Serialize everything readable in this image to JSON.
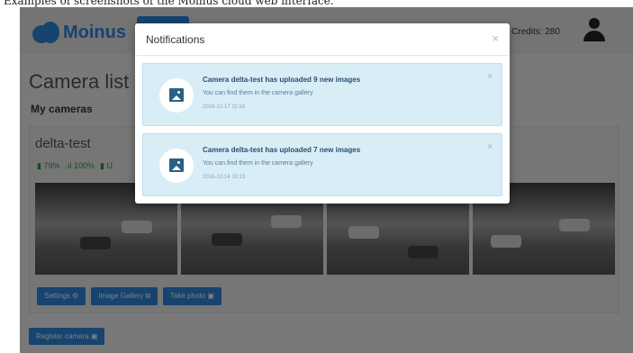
{
  "caption": "Examples of screenshots of the Moinus cloud web interface.",
  "app": {
    "logo_text": "Moinus",
    "credits": "Credits: 280",
    "page_title": "Camera list",
    "section_title": "My cameras",
    "camera": {
      "name": "delta-test",
      "stats": [
        "▮ 79%",
        ".ıl 100%",
        "▮ U"
      ],
      "buttons": [
        "Settings ⚙",
        "Image Gallery ⧉",
        "Take photo ▣"
      ]
    },
    "register_button": "Register camera ▣"
  },
  "modal": {
    "title": "Notifications",
    "close": "×",
    "notifications": [
      {
        "title": "Camera delta-test has uploaded 9 new images",
        "text": "You can find them in the camera gallery",
        "date": "2016-12-17 11:19",
        "close": "×"
      },
      {
        "title": "Camera delta-test has uploaded 7 new images",
        "text": "You can find them in the camera gallery",
        "date": "2016-12-14 10:13",
        "close": "×"
      }
    ]
  },
  "colors": {
    "accent": "#2e86de",
    "notification_bg": "#d9edf7",
    "overlay": "rgba(0,0,0,0.5)"
  }
}
